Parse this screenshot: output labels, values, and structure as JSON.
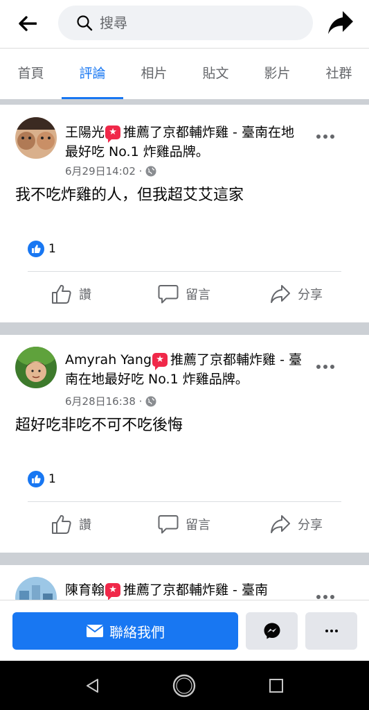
{
  "search": {
    "placeholder": "搜尋"
  },
  "tabs": [
    {
      "label": "首頁"
    },
    {
      "label": "評論"
    },
    {
      "label": "相片"
    },
    {
      "label": "貼文"
    },
    {
      "label": "影片"
    },
    {
      "label": "社群"
    }
  ],
  "active_tab": "評論",
  "posts": [
    {
      "author": "王陽光",
      "text_after": "推薦了京都輔炸雞 - 臺南在地最好吃 No.1 炸雞品牌。",
      "time": "6月29日14:02",
      "separator": "·",
      "body": "我不吃炸雞的人，但我超艾艾這家",
      "like_count": "1",
      "actions": {
        "like": "讚",
        "comment": "留言",
        "share": "分享"
      }
    },
    {
      "author": "Amyrah Yang",
      "text_after": "推薦了京都輔炸雞 - 臺南在地最好吃 No.1 炸雞品牌。",
      "time": "6月28日16:38",
      "separator": "·",
      "body": "超好吃非吃不可不吃後悔",
      "like_count": "1",
      "actions": {
        "like": "讚",
        "comment": "留言",
        "share": "分享"
      }
    },
    {
      "author": "陳育翰",
      "text_after": "推薦了京都輔炸雞 - 臺南"
    }
  ],
  "contact": {
    "label": "聯絡我們"
  },
  "colors": {
    "accent": "#1877f2",
    "badge": "#f02849",
    "muted": "#65676b"
  }
}
